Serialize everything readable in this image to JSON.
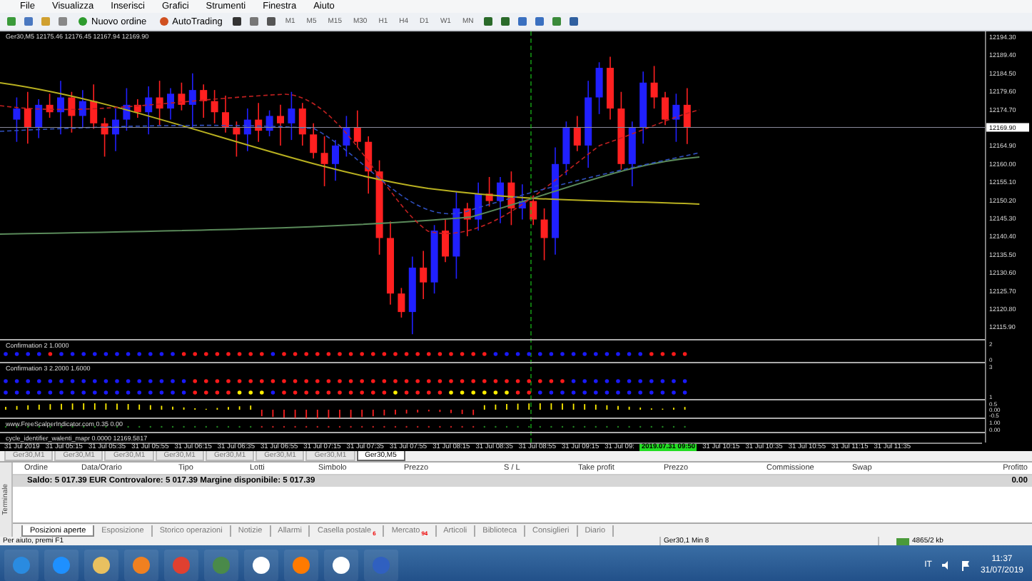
{
  "menu": [
    "File",
    "Visualizza",
    "Inserisci",
    "Grafici",
    "Strumenti",
    "Finestra",
    "Aiuto"
  ],
  "toolbar": {
    "buttons": [
      {
        "label": "Nuovo ordine"
      },
      {
        "label": "AutoTrading"
      }
    ],
    "timeframes": [
      "M1",
      "M5",
      "M15",
      "M30",
      "H1",
      "H4",
      "D1",
      "W1",
      "MN"
    ]
  },
  "chart": {
    "header": "Ger30,M5  12175.46 12176.45 12167.94 12169.90",
    "price_labels": [
      "12194.30",
      "12189.40",
      "12184.50",
      "12179.60",
      "12174.70",
      "12164.90",
      "12160.00",
      "12155.10",
      "12150.20",
      "12145.30",
      "12140.40",
      "12135.50",
      "12130.60",
      "12125.70",
      "12120.80",
      "12115.90"
    ],
    "current_price": "12169.90",
    "indicators": [
      {
        "title": "Confirmation 2 1.0000",
        "scale": [
          "2",
          "0"
        ]
      },
      {
        "title": "Confirmation 3 2.2000 1.6000",
        "scale": [
          "3",
          "1"
        ]
      },
      {
        "scale": [
          "0.5",
          "0.00",
          "-0.5"
        ]
      },
      {
        "title": "www.FreeScalperIndicator.com  0.35 0.00",
        "scale": [
          "1.00",
          "0.00"
        ]
      },
      {
        "title": "cycle_identifier_walenti_mapr 0.0000 12169.5817"
      }
    ],
    "time_labels": [
      {
        "text": "31 Jul 2019",
        "highlighted": false
      },
      {
        "text": "31 Jul 05:15",
        "highlighted": false
      },
      {
        "text": "31 Jul 05:35",
        "highlighted": false
      },
      {
        "text": "31 Jul 05:55",
        "highlighted": false
      },
      {
        "text": "31 Jul 06:15",
        "highlighted": false
      },
      {
        "text": "31 Jul 06:35",
        "highlighted": false
      },
      {
        "text": "31 Jul 06:55",
        "highlighted": false
      },
      {
        "text": "31 Jul 07:15",
        "highlighted": false
      },
      {
        "text": "31 Jul 07:35",
        "highlighted": false
      },
      {
        "text": "31 Jul 07:55",
        "highlighted": false
      },
      {
        "text": "31 Jul 08:15",
        "highlighted": false
      },
      {
        "text": "31 Jul 08:35",
        "highlighted": false
      },
      {
        "text": "31 Jul 08:55",
        "highlighted": false
      },
      {
        "text": "31 Jul 09:15",
        "highlighted": false
      },
      {
        "text": "31 Jul 09:",
        "highlighted": false
      },
      {
        "text": "2019.07.31 09:50",
        "highlighted": true
      },
      {
        "text": "31 Jul 10:15",
        "highlighted": false
      },
      {
        "text": "31 Jul 10:35",
        "highlighted": false
      },
      {
        "text": "31 Jul 10:55",
        "highlighted": false
      },
      {
        "text": "31 Jul 11:15",
        "highlighted": false
      },
      {
        "text": "31 Jul 11:35",
        "highlighted": false
      }
    ]
  },
  "symbol_tabs": [
    {
      "label": "Ger30,M1",
      "selected": false
    },
    {
      "label": "Ger30,M1",
      "selected": false
    },
    {
      "label": "Ger30,M1",
      "selected": false
    },
    {
      "label": "Ger30,M1",
      "selected": false
    },
    {
      "label": "Ger30,M1",
      "selected": false
    },
    {
      "label": "Ger30,M1",
      "selected": false
    },
    {
      "label": "Ger30,M1",
      "selected": false
    },
    {
      "label": "Ger30,M5",
      "selected": true
    }
  ],
  "terminal": {
    "side_label": "Terminale",
    "columns": [
      "Ordine",
      "Data/Orario",
      "Tipo",
      "Lotti",
      "Simbolo",
      "Prezzo",
      "S / L",
      "Take profit",
      "Prezzo",
      "Commissione",
      "Swap",
      "Profitto"
    ],
    "balance": "Saldo: 5 017.39 EUR  Controvalore: 5 017.39  Margine disponibile: 5 017.39",
    "profit": "0.00",
    "tabs": [
      {
        "label": "Posizioni aperte",
        "selected": true
      },
      {
        "label": "Esposizione",
        "selected": false
      },
      {
        "label": "Storico operazioni",
        "selected": false
      },
      {
        "label": "Notizie",
        "selected": false
      },
      {
        "label": "Allarmi",
        "selected": false
      },
      {
        "label": "Casella postale",
        "selected": false,
        "badge": "6"
      },
      {
        "label": "Mercato",
        "selected": false,
        "badge": "94"
      },
      {
        "label": "Articoli",
        "selected": false
      },
      {
        "label": "Biblioteca",
        "selected": false
      },
      {
        "label": "Consiglieri",
        "selected": false
      },
      {
        "label": "Diario",
        "selected": false
      }
    ]
  },
  "status_bar": {
    "help": "Per aiuto, premi F1",
    "profile": "Ger30,1 Min 8",
    "traffic": "4865/2 kb"
  },
  "taskbar": {
    "language": "IT",
    "time": "11:37",
    "date": "31/07/2019"
  }
}
